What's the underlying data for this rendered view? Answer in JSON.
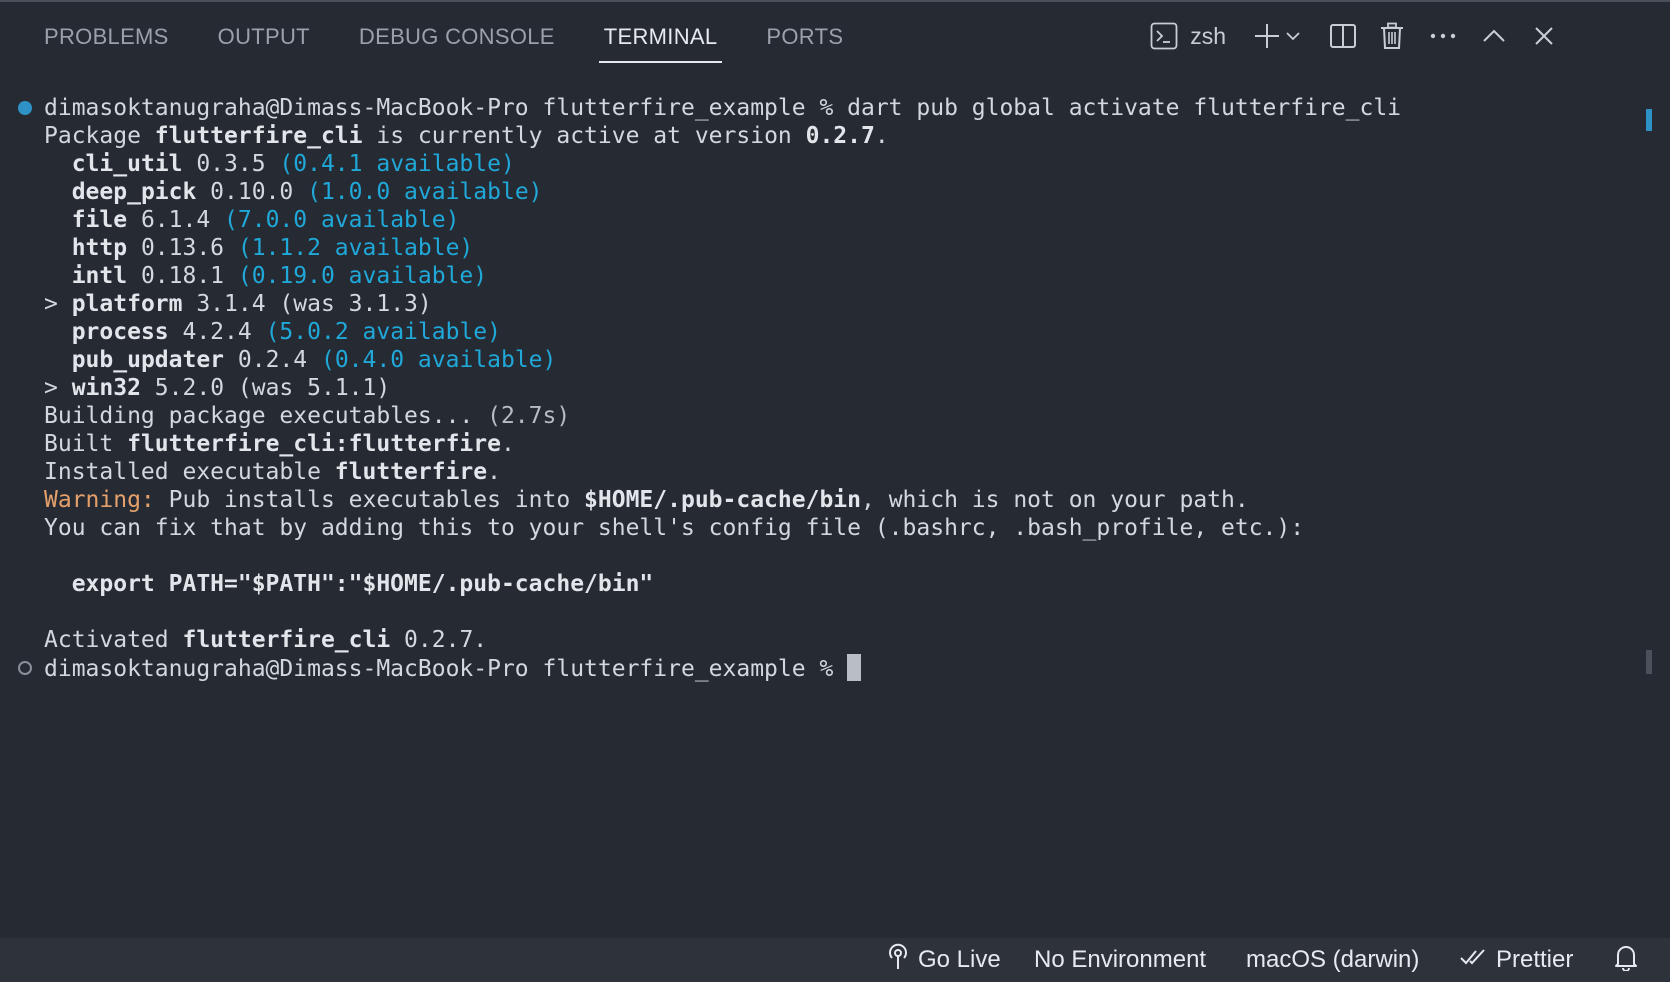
{
  "tabs": [
    {
      "label": "PROBLEMS"
    },
    {
      "label": "OUTPUT"
    },
    {
      "label": "DEBUG CONSOLE"
    },
    {
      "label": "TERMINAL",
      "active": true
    },
    {
      "label": "PORTS"
    }
  ],
  "terminal_toolbar": {
    "shell": "zsh",
    "icons": [
      "terminal-icon",
      "plus-icon",
      "chevron-down-icon",
      "split-icon",
      "trash-icon",
      "more-icon",
      "chevron-up-icon",
      "close-icon"
    ]
  },
  "terminal": {
    "prompt": "dimasoktanugraha@Dimass-MacBook-Pro flutterfire_example % ",
    "command": "dart pub global activate flutterfire_cli",
    "l1": {
      "pre": "Package ",
      "pkg": "flutterfire_cli",
      "mid": " is currently active at version ",
      "ver": "0.2.7",
      "end": "."
    },
    "deps": [
      {
        "marker": "  ",
        "name": "cli_util",
        "version": " 0.3.5 ",
        "note": "(0.4.1 available)",
        "kind": "available"
      },
      {
        "marker": "  ",
        "name": "deep_pick",
        "version": " 0.10.0 ",
        "note": "(1.0.0 available)",
        "kind": "available"
      },
      {
        "marker": "  ",
        "name": "file",
        "version": " 6.1.4 ",
        "note": "(7.0.0 available)",
        "kind": "available"
      },
      {
        "marker": "  ",
        "name": "http",
        "version": " 0.13.6 ",
        "note": "(1.1.2 available)",
        "kind": "available"
      },
      {
        "marker": "  ",
        "name": "intl",
        "version": " 0.18.1 ",
        "note": "(0.19.0 available)",
        "kind": "available"
      },
      {
        "marker": "> ",
        "name": "platform",
        "version": " 3.1.4 ",
        "note": "(was 3.1.3)",
        "kind": "was"
      },
      {
        "marker": "  ",
        "name": "process",
        "version": " 4.2.4 ",
        "note": "(5.0.2 available)",
        "kind": "available"
      },
      {
        "marker": "  ",
        "name": "pub_updater",
        "version": " 0.2.4 ",
        "note": "(0.4.0 available)",
        "kind": "available"
      },
      {
        "marker": "> ",
        "name": "win32",
        "version": " 5.2.0 ",
        "note": "(was 5.1.1)",
        "kind": "was"
      }
    ],
    "building": {
      "text": "Building package executables... ",
      "time": "(2.7s)"
    },
    "built": {
      "pre": "Built ",
      "name": "flutterfire_cli:flutterfire",
      "end": "."
    },
    "installed": {
      "pre": "Installed executable ",
      "name": "flutterfire",
      "end": "."
    },
    "warning": {
      "label": "Warning:",
      "pre": " Pub installs executables into ",
      "path": "$HOME/.pub-cache/bin",
      "post": ", which is not on your path."
    },
    "fix": "You can fix that by adding this to your shell's config file (.bashrc, .bash_profile, etc.):",
    "export": "  export PATH=\"$PATH\":\"$HOME/.pub-cache/bin\"",
    "activated": {
      "pre": "Activated ",
      "name": "flutterfire_cli",
      "ver": " 0.2.7."
    },
    "prompt2": "dimasoktanugraha@Dimass-MacBook-Pro flutterfire_example % "
  },
  "statusbar": {
    "go_live": "Go Live",
    "environment": "No Environment",
    "os": "macOS (darwin)",
    "prettier": "Prettier"
  },
  "colors": {
    "accent": "#2f92c6",
    "available": "#1fa8d8",
    "warning": "#e5a16b"
  }
}
